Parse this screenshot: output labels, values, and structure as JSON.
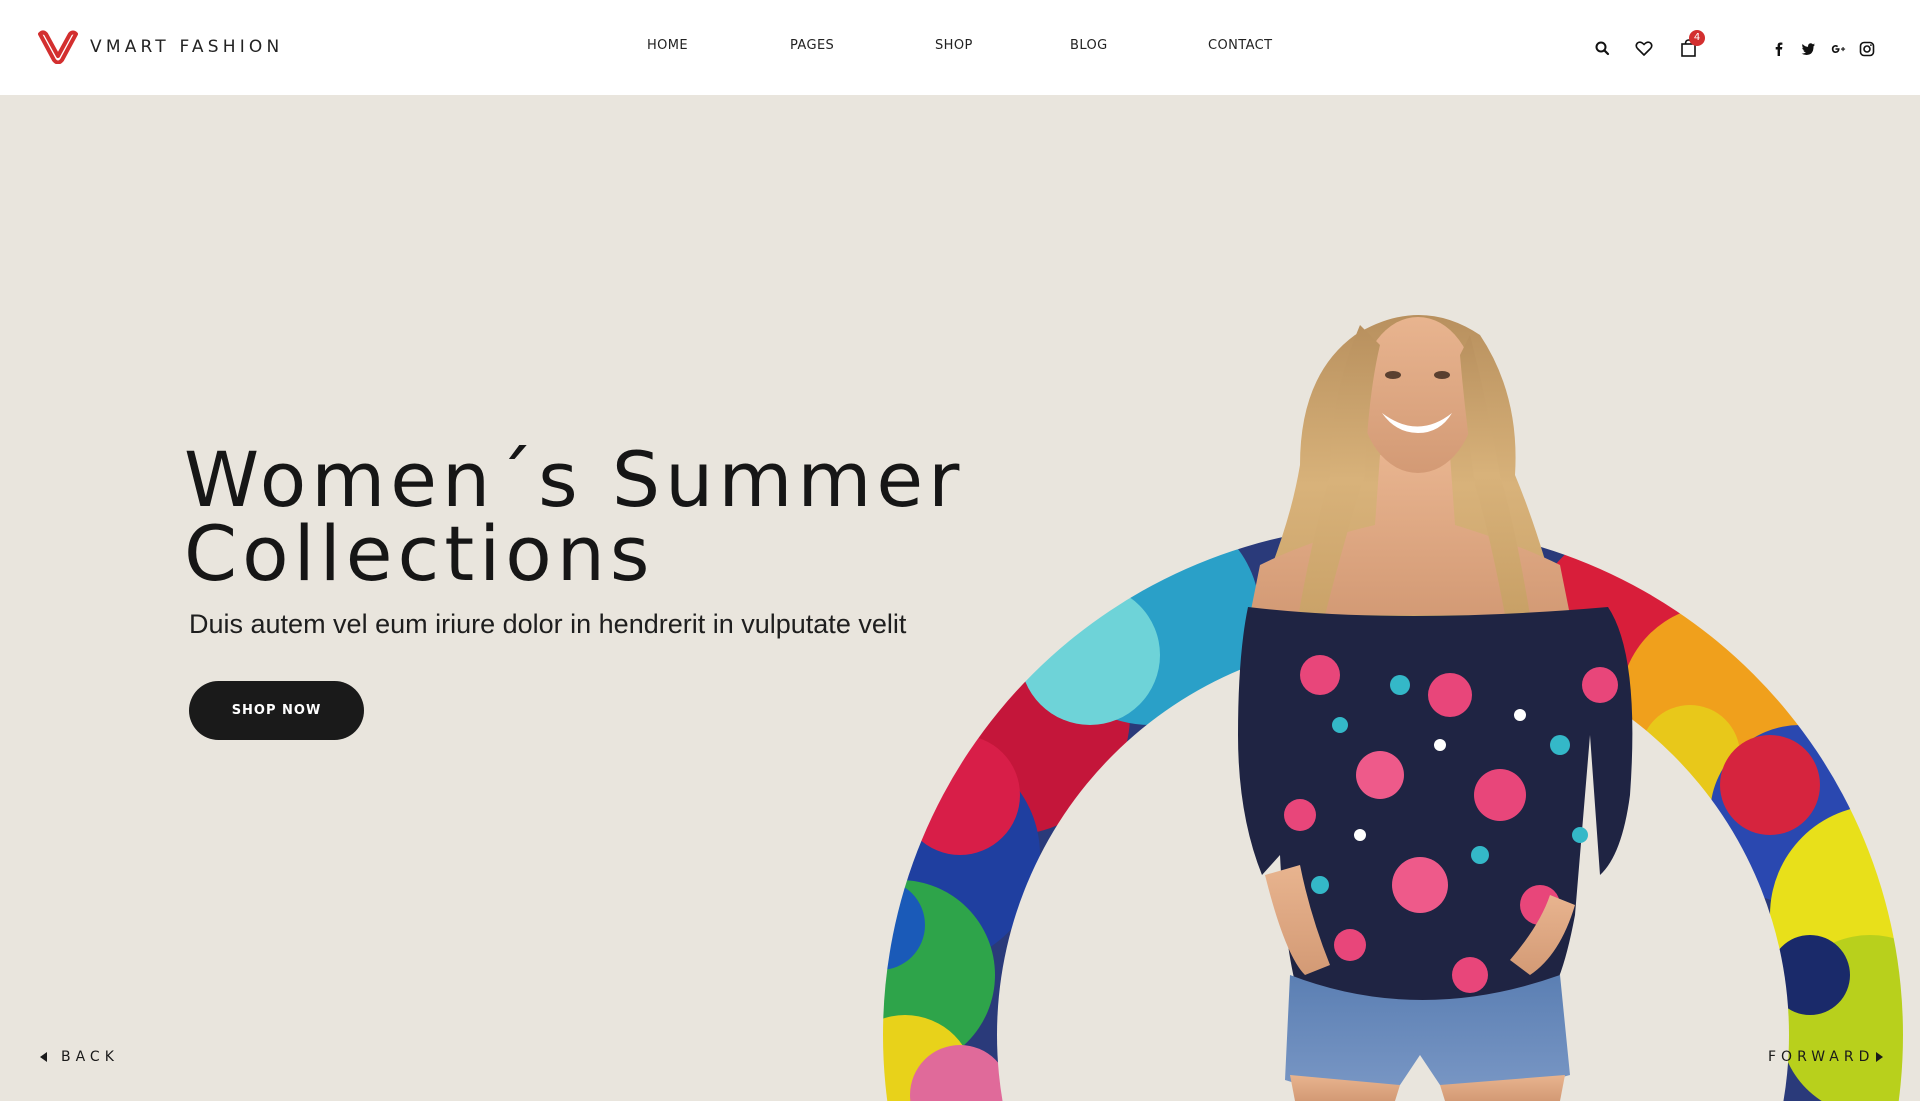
{
  "brand": {
    "name": "VMART FASHION",
    "logo_color": "#d32f2f"
  },
  "nav": {
    "items": [
      {
        "label": "HOME"
      },
      {
        "label": "PAGES"
      },
      {
        "label": "SHOP"
      },
      {
        "label": "BLOG"
      },
      {
        "label": "CONTACT"
      }
    ]
  },
  "toolbar": {
    "search_icon": "search-icon",
    "wishlist_icon": "heart-icon",
    "cart_icon": "shopping-bag-icon",
    "cart_count": "4"
  },
  "social": [
    "facebook-icon",
    "twitter-icon",
    "google-plus-icon",
    "instagram-icon"
  ],
  "hero": {
    "title_line1": "Women´s Summer",
    "title_line2": "Collections",
    "subtitle": "Duis autem vel eum iriure dolor in hendrerit in vulputate velit",
    "cta_label": "SHOP NOW",
    "background": "#e9e5dd"
  },
  "slider": {
    "back_label": "BACK",
    "forward_label": "FORWARD"
  }
}
